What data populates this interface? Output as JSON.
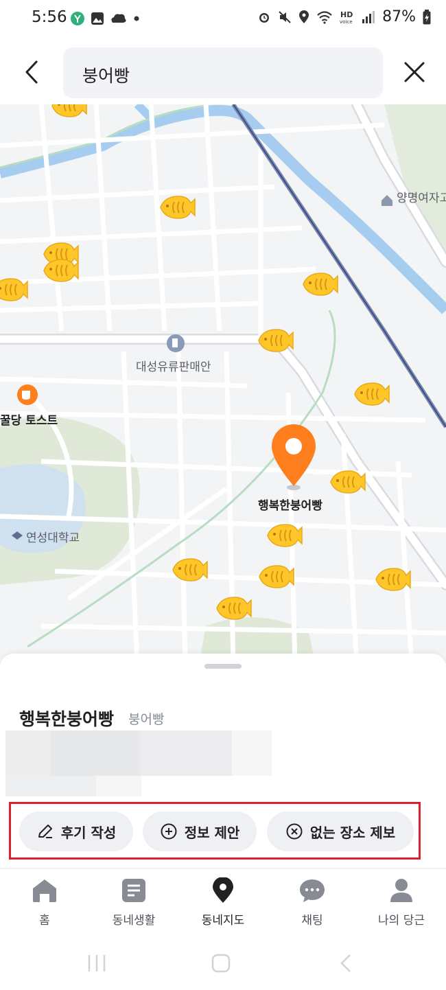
{
  "status_bar": {
    "time": "5:56",
    "battery": "87%",
    "left_icons": [
      "money-icon",
      "gallery-icon",
      "cloud-icon",
      "dot-icon"
    ],
    "right_icons": [
      "alarm-icon",
      "mute-icon",
      "location-icon",
      "wifi-icon",
      "hd-voice-icon",
      "signal-icon",
      "battery-icon"
    ]
  },
  "header": {
    "search_value": "붕어빵"
  },
  "map": {
    "labels": {
      "school_top": "양명여자고",
      "gas_station": "대성유류판매안",
      "cafe": "꿀당 토스트",
      "university": "연성대학교",
      "selected_place": "행복한붕어빵"
    },
    "pin_count": 15,
    "colors": {
      "pin_orange": "#ff7e1d",
      "bungeo_yellow": "#ffc629",
      "water": "#a6cdf0",
      "park": "#dbe8d4"
    }
  },
  "sheet": {
    "title": "행복한붕어빵",
    "category": "붕어빵",
    "actions": [
      {
        "label": "후기 작성",
        "icon": "pencil-icon"
      },
      {
        "label": "정보 제안",
        "icon": "plus-circle-icon"
      },
      {
        "label": "없는 장소 제보",
        "icon": "x-circle-icon"
      }
    ]
  },
  "bottom_nav": {
    "items": [
      {
        "label": "홈",
        "icon": "home-icon"
      },
      {
        "label": "동네생활",
        "icon": "board-icon"
      },
      {
        "label": "동네지도",
        "icon": "map-pin-icon",
        "active": true
      },
      {
        "label": "채팅",
        "icon": "chat-icon"
      },
      {
        "label": "나의 당근",
        "icon": "person-icon"
      }
    ]
  }
}
